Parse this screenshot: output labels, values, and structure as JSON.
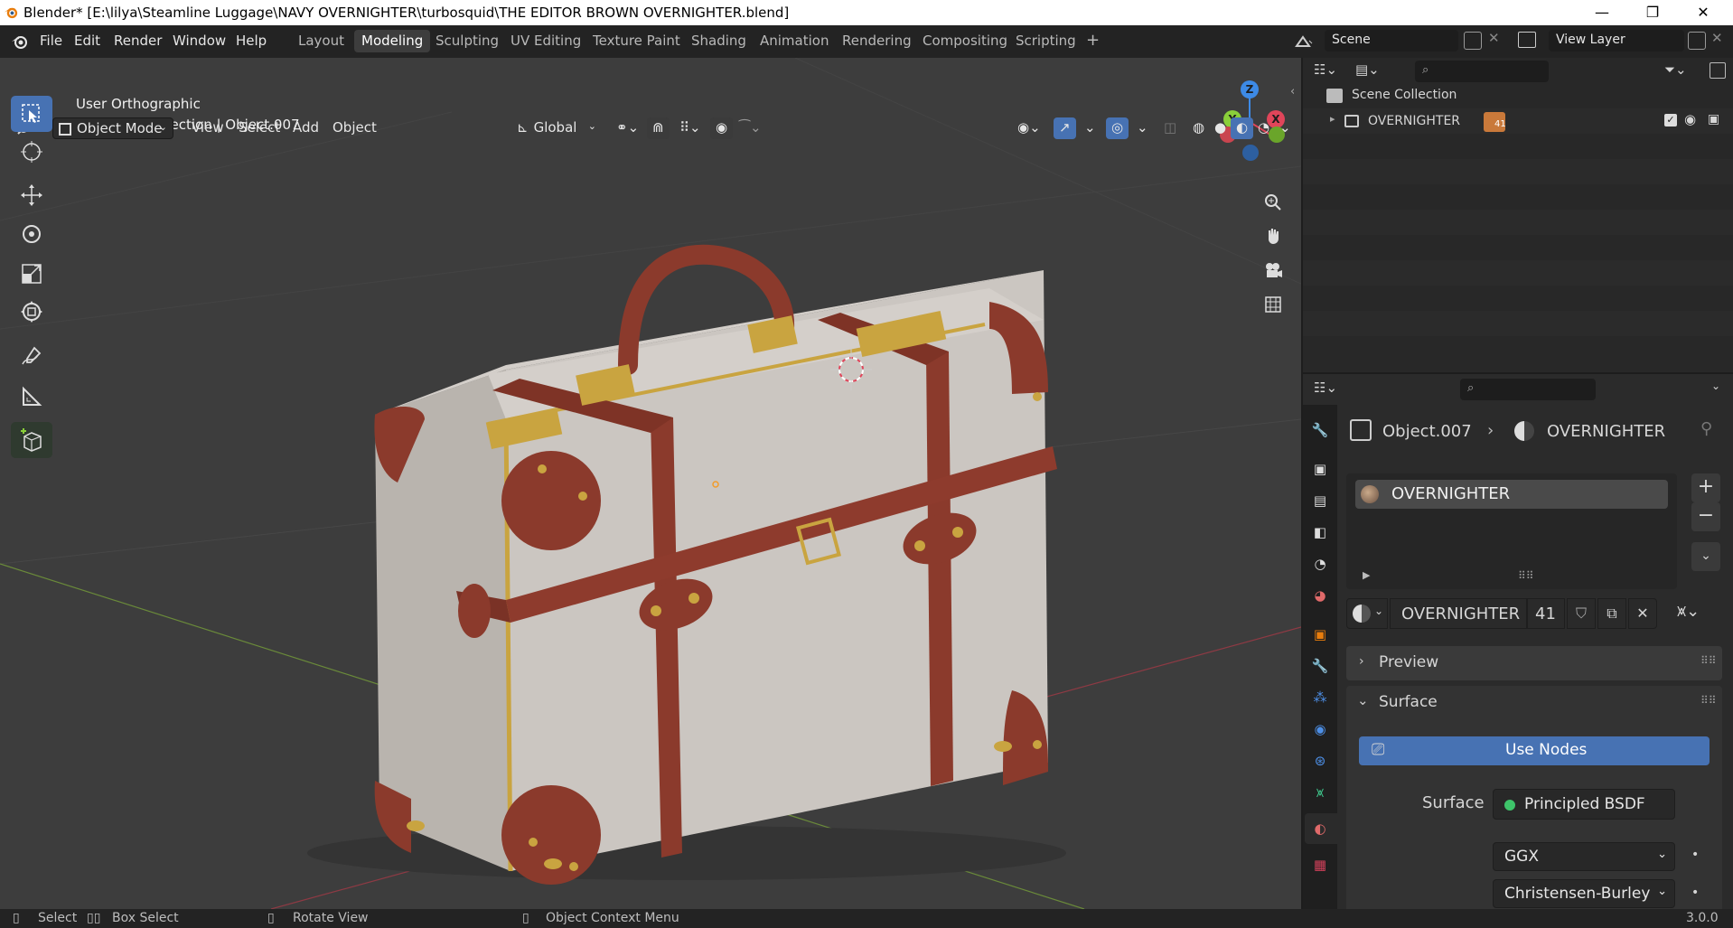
{
  "window": {
    "title": "Blender* [E:\\lilya\\Steamline Luggage\\NAVY OVERNIGHTER\\turbosquid\\THE EDITOR BROWN OVERNIGHTER.blend]",
    "minimize": "—",
    "maximize": "❐",
    "close": "✕"
  },
  "menu": {
    "items": [
      "File",
      "Edit",
      "Render",
      "Window",
      "Help"
    ]
  },
  "workspaces": {
    "tabs": [
      "Layout",
      "Modeling",
      "Sculpting",
      "UV Editing",
      "Texture Paint",
      "Shading",
      "Animation",
      "Rendering",
      "Compositing",
      "Scripting"
    ],
    "active": "Modeling",
    "add": "+"
  },
  "scene": {
    "name": "Scene",
    "view_layer": "View Layer"
  },
  "viewport": {
    "mode": "Object Mode",
    "menus": [
      "View",
      "Select",
      "Add",
      "Object"
    ],
    "orientation": "Global",
    "view_name": "User Orthographic",
    "context": "(1) Scene Collection | Object.007",
    "gizmo": {
      "z": "Z",
      "y": "Y",
      "x": "X"
    }
  },
  "outliner": {
    "root": "Scene Collection",
    "items": [
      {
        "name": "OVERNIGHTER",
        "badge": "41"
      }
    ]
  },
  "properties": {
    "breadcrumb_object": "Object.007",
    "breadcrumb_material": "OVERNIGHTER",
    "material_slot": "OVERNIGHTER",
    "material_name": "OVERNIGHTER",
    "users": "41",
    "panels": {
      "preview": "Preview",
      "surface": "Surface"
    },
    "use_nodes": "Use Nodes",
    "surface_label": "Surface",
    "surface_shader": "Principled BSDF",
    "distribution": "GGX",
    "subsurface_method": "Christensen-Burley"
  },
  "statusbar": {
    "select": "Select",
    "box_select": "Box Select",
    "rotate_view": "Rotate View",
    "context_menu": "Object Context Menu",
    "version": "3.0.0"
  },
  "colors": {
    "accent_blue": "#4772b3",
    "axis_x": "#e0455a",
    "axis_y": "#8acf3a",
    "axis_z": "#3d8ae6",
    "case_canvas": "#c9c4bf",
    "leather": "#8b3a2c",
    "brass": "#c9a440"
  }
}
